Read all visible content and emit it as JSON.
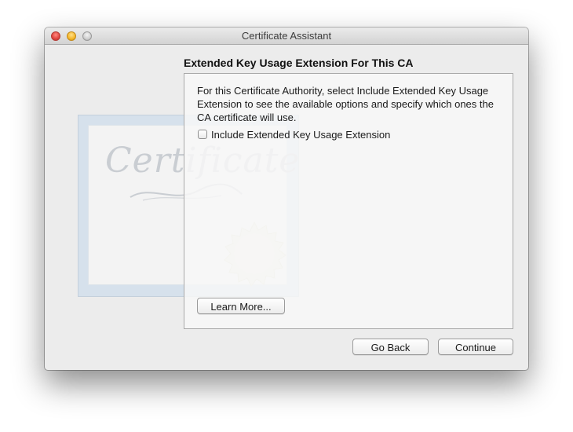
{
  "window": {
    "title": "Certificate Assistant"
  },
  "artwork": {
    "certificate_word": "Certificate"
  },
  "page": {
    "heading": "Extended Key Usage Extension For This CA",
    "description": "For this Certificate Authority, select Include Extended Key Usage Extension to see the available options and specify which ones the CA certificate will use.",
    "checkbox_label": "Include Extended Key Usage Extension",
    "checkbox_checked": false,
    "learn_more_label": "Learn More..."
  },
  "footer": {
    "back_label": "Go Back",
    "continue_label": "Continue"
  },
  "colors": {
    "window_background": "#ececec",
    "close_button": "#e0443e",
    "minimize_button": "#f5b72a",
    "zoom_button": "#cfcfcf"
  }
}
